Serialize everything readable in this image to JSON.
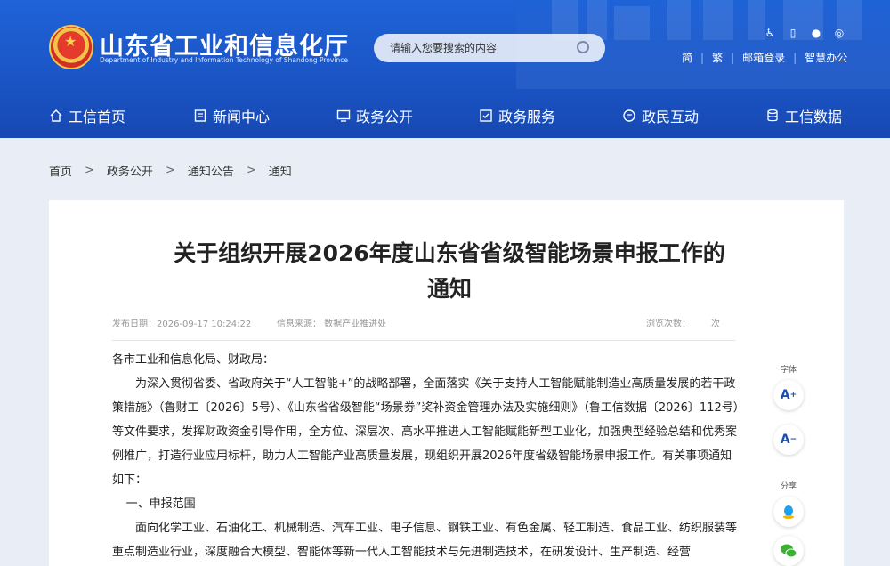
{
  "header": {
    "title": "山东省工业和信息化厅",
    "subtitle": "Department of Industry and Information Technology of Shandong Province",
    "search_placeholder": "请输入您要搜索的内容",
    "top_links": [
      "简",
      "繁",
      "邮箱登录",
      "智慧办公"
    ]
  },
  "nav": [
    {
      "label": "工信首页",
      "icon": "home-icon"
    },
    {
      "label": "新闻中心",
      "icon": "news-icon"
    },
    {
      "label": "政务公开",
      "icon": "monitor-icon"
    },
    {
      "label": "政务服务",
      "icon": "service-icon"
    },
    {
      "label": "政民互动",
      "icon": "chat-icon"
    },
    {
      "label": "工信数据",
      "icon": "database-icon"
    }
  ],
  "breadcrumb": [
    "首页",
    "政务公开",
    "通知公告",
    "通知"
  ],
  "article": {
    "title_line1": "关于组织开展2026年度山东省省级智能场景申报工作的",
    "title_line2": "通知",
    "publish_date": "发布日期：2026-09-17 10:24:22",
    "source": "信息来源：  数据产业推进处",
    "views": "浏览次数：",
    "views_unit": "次",
    "greeting": "各市工业和信息化局、财政局：",
    "para1": "为深入贯彻省委、省政府关于“人工智能+”的战略部署，全面落实《关于支持人工智能赋能制造业高质量发展的若干政策措施》（鲁财工〔2026〕5号）、《山东省省级智能“场景券”奖补资金管理办法及实施细则》（鲁工信数据〔2026〕112号）等文件要求，发挥财政资金引导作用，全方位、深层次、高水平推进人工智能赋能新型工业化，加强典型经验总结和优秀案例推广，打造行业应用标杆，助力人工智能产业高质量发展，现组织开展2026年度省级智能场景申报工作。有关事项通知如下：",
    "section1": "一、申报范围",
    "para2": "面向化学工业、石油化工、机械制造、汽车工业、电子信息、钢铁工业、有色金属、轻工制造、食品工业、纺织服装等重点制造业行业，深度融合大模型、智能体等新一代人工智能技术与先进制造技术，在研发设计、生产制造、经营"
  },
  "tools": {
    "font_label": "字体",
    "font_increase": "A",
    "font_decrease": "A",
    "share_label": "分享"
  }
}
